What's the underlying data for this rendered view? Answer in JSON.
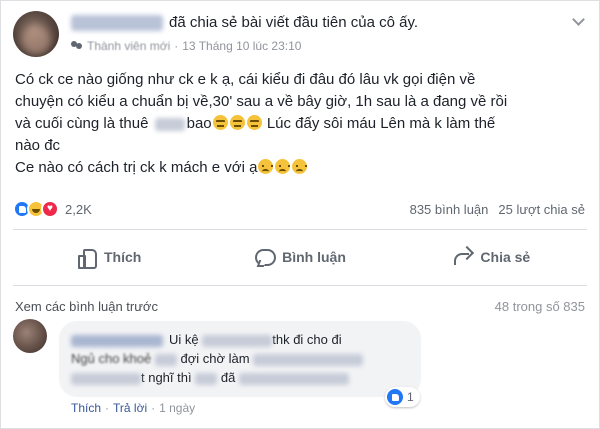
{
  "post": {
    "header_text": "đã chia sẻ bài viết đầu tiên của cô ấy.",
    "member_badge": "Thành viên mới",
    "timestamp": "13 Tháng 10 lúc 23:10",
    "body": {
      "line1": "Có ck ce nào giống như ck e k ạ, cái kiểu đi đâu đó lâu vk gọi điện về",
      "line2": "chuyện có kiểu a chuẩn bị về,30' sau a về bây giờ, 1h sau là a đang về rồi",
      "line3_a": "và cuối cùng là thuê",
      "line3_b": "bao",
      "line3_c": "Lúc đấy sôi máu Lên mà k làm thế",
      "line4": "nào đc",
      "line5": "Ce nào có cách trị ck k mách e với ạ"
    },
    "reaction_count": "2,2K",
    "comment_count": "835 bình luận",
    "share_count": "25 lượt chia sẻ",
    "actions": {
      "like": "Thích",
      "comment": "Bình luận",
      "share": "Chia sẻ"
    }
  },
  "comments_section": {
    "view_previous": "Xem các bình luận trước",
    "counter": "48 trong số 835",
    "comment": {
      "line1_a": "Ui kệ",
      "line1_b": "thk đi cho đi",
      "line2_a": "Ngủ cho khoẻ",
      "line2_b": "đợi chờ làm",
      "line3_a": "t nghĩ thì",
      "line3_b": "đã",
      "reaction_count": "1",
      "like": "Thích",
      "reply": "Trả lời",
      "time": "1 ngày"
    }
  },
  "colors": {
    "link": "#385898",
    "secondary_text": "#606770",
    "like_blue": "#2078f4",
    "love_red": "#f0284a",
    "haha_yellow": "#f7c33b"
  }
}
